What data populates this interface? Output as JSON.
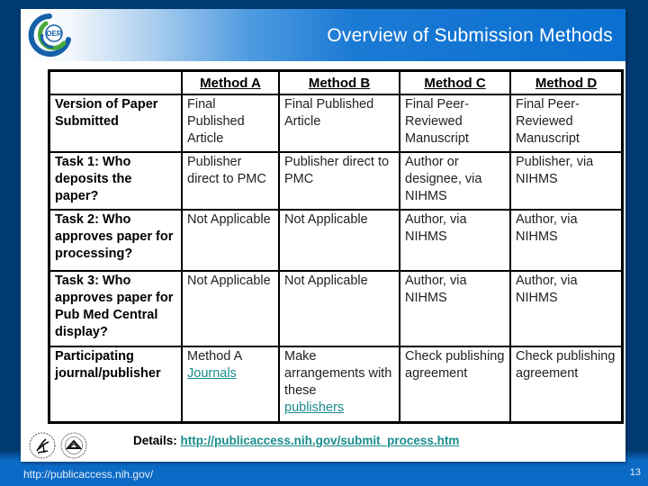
{
  "header": {
    "title": "Overview of Submission Methods",
    "logo_text": "OER"
  },
  "table": {
    "columns": [
      "",
      "Method A",
      "Method B",
      "Method C",
      "Method D"
    ],
    "rows": [
      {
        "label": "Version of Paper Submitted",
        "cells": [
          "Final Published Article",
          "Final Published Article",
          "Final Peer-Reviewed Manuscript",
          "Final Peer-Reviewed Manuscript"
        ]
      },
      {
        "label": "Task 1: Who deposits the paper?",
        "cells": [
          "Publisher direct to PMC",
          "Publisher direct to PMC",
          "Author or designee, via NIHMS",
          "Publisher, via NIHMS"
        ]
      },
      {
        "label": "Task 2: Who approves paper for processing?",
        "cells": [
          "Not Applicable",
          "Not Applicable",
          "Author, via NIHMS",
          "Author, via NIHMS"
        ]
      },
      {
        "label": "Task 3: Who approves paper for Pub Med Central display?",
        "cells": [
          "Not Applicable",
          "Not Applicable",
          "Author, via NIHMS",
          "Author, via NIHMS"
        ]
      },
      {
        "label": "Participating journal/publisher",
        "cells": [
          {
            "text": "Method A",
            "link": "Journals"
          },
          {
            "text": "Make arrangements with these",
            "link": "publishers"
          },
          "Check publishing agreement",
          "Check publishing agreement"
        ]
      }
    ]
  },
  "details": {
    "label": "Details:",
    "link": "http://publicaccess.nih.gov/submit_process.htm"
  },
  "footer": {
    "url": "http://publicaccess.nih.gov/",
    "slide_number": "13"
  },
  "colors": {
    "background_dark": "#003a70",
    "background_light": "#0b6ac6",
    "title_blue": "#0a6fd0",
    "link": "#1a8c8c",
    "logo_blue": "#1560a8",
    "logo_green": "#4aa83c"
  }
}
